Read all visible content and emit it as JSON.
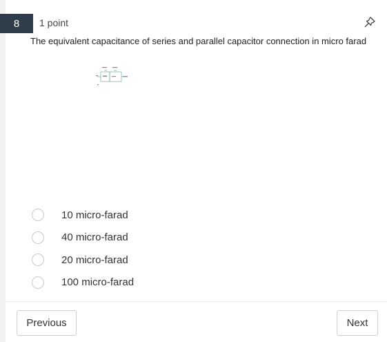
{
  "question": {
    "number": "8",
    "points": "1 point",
    "text": "The equivalent capacitance of series and parallel capacitor connection in micro farad",
    "pin_icon": "pin-icon",
    "figure_icon": "capacitor-circuit-diagram"
  },
  "options": [
    {
      "label": "10 micro-farad",
      "selected": false
    },
    {
      "label": "40 micro-farad",
      "selected": false
    },
    {
      "label": "20 micro-farad",
      "selected": false
    },
    {
      "label": "100 micro-farad",
      "selected": false
    }
  ],
  "navigation": {
    "previous_label": "Previous",
    "next_label": "Next"
  },
  "colors": {
    "number_badge_bg": "#2f3d4a",
    "number_badge_text": "#ffffff"
  }
}
